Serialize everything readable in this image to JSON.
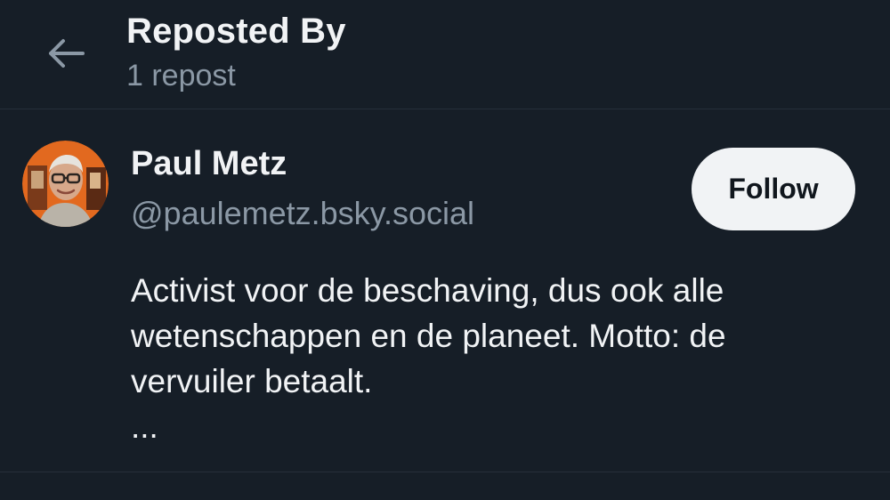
{
  "header": {
    "back_icon": "arrow-left-icon",
    "title": "Reposted By",
    "subtitle": "1 repost"
  },
  "user": {
    "name": "Paul Metz",
    "handle": "@paulemetz.bsky.social",
    "follow_label": "Follow",
    "avatar_icon": "profile-photo",
    "bio_lines": [
      "Activist voor de beschaving, dus ook alle",
      "wetenschappen en de planeet. Motto: de",
      "vervuiler betaalt.",
      "..."
    ]
  },
  "colors": {
    "background": "#161e27",
    "text_primary": "#f1f3f5",
    "text_secondary": "#8b98a5",
    "button_bg": "#f1f3f5",
    "avatar_bg": "#e2691f"
  }
}
